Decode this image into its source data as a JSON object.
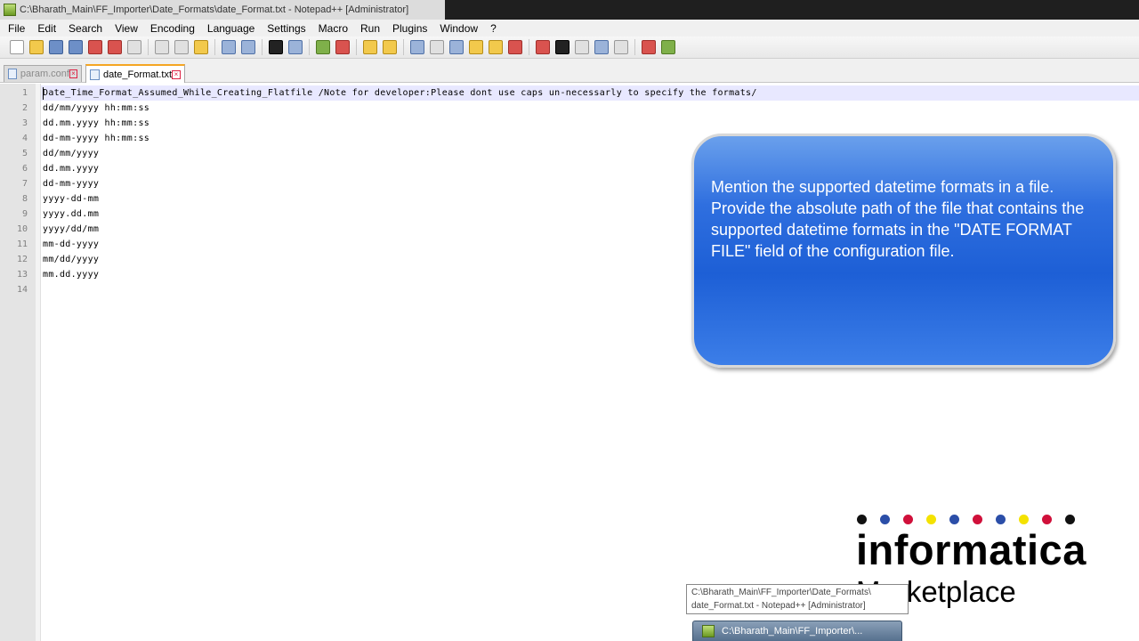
{
  "window": {
    "title": "C:\\Bharath_Main\\FF_Importer\\Date_Formats\\date_Format.txt - Notepad++ [Administrator]"
  },
  "menu": [
    "File",
    "Edit",
    "Search",
    "View",
    "Encoding",
    "Language",
    "Settings",
    "Macro",
    "Run",
    "Plugins",
    "Window",
    "?"
  ],
  "tabs": [
    {
      "label": "param.conf",
      "active": false
    },
    {
      "label": "date_Format.txt",
      "active": true
    }
  ],
  "editor": {
    "lines": [
      {
        "num": "1",
        "text": "Date_Time_Format_Assumed_While_Creating_Flatfile /Note for developer:Please dont use caps un-necessarly to specify the formats/"
      },
      {
        "num": "2",
        "text": "dd/mm/yyyy hh:mm:ss"
      },
      {
        "num": "3",
        "text": "dd.mm.yyyy hh:mm:ss"
      },
      {
        "num": "4",
        "text": "dd-mm-yyyy hh:mm:ss"
      },
      {
        "num": "5",
        "text": "dd/mm/yyyy"
      },
      {
        "num": "6",
        "text": "dd.mm.yyyy"
      },
      {
        "num": "7",
        "text": "dd-mm-yyyy"
      },
      {
        "num": "8",
        "text": "yyyy-dd-mm"
      },
      {
        "num": "9",
        "text": "yyyy.dd.mm"
      },
      {
        "num": "10",
        "text": "yyyy/dd/mm"
      },
      {
        "num": "11",
        "text": "mm-dd-yyyy"
      },
      {
        "num": "12",
        "text": "mm/dd/yyyy"
      },
      {
        "num": "13",
        "text": "mm.dd.yyyy"
      },
      {
        "num": "14",
        "text": ""
      }
    ]
  },
  "callout": {
    "paragraphs": [
      "Mention the supported datetime formats in a file.",
      "Provide the absolute path of the file that contains the supported datetime formats in the \"DATE FORMAT FILE\" field of the configuration file."
    ]
  },
  "logo": {
    "word": "informatica",
    "sub": "Marketplace",
    "dot_colors": [
      "#111111",
      "#2b4ea8",
      "#d0103a",
      "#f4e200",
      "#2b4ea8",
      "#d0103a",
      "#2b4ea8",
      "#f4e200",
      "#d0103a",
      "#111111"
    ]
  },
  "taskbar": {
    "tooltip_line1": "C:\\Bharath_Main\\FF_Importer\\Date_Formats\\",
    "tooltip_line2": "date_Format.txt - Notepad++ [Administrator]",
    "button_label": "C:\\Bharath_Main\\FF_Importer\\..."
  },
  "colors": {
    "callout_blue": "#1d5fd6",
    "active_tab_accent": "#f5a623",
    "gutter": "#e4e4e4"
  }
}
